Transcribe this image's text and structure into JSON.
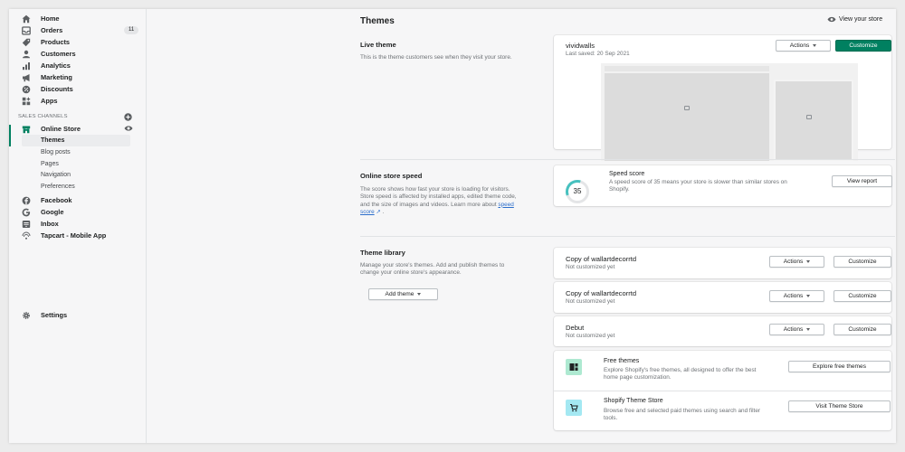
{
  "sidebar": {
    "items": [
      {
        "label": "Home",
        "icon": "home-icon"
      },
      {
        "label": "Orders",
        "icon": "orders-icon",
        "badge": "11"
      },
      {
        "label": "Products",
        "icon": "products-icon"
      },
      {
        "label": "Customers",
        "icon": "customers-icon"
      },
      {
        "label": "Analytics",
        "icon": "analytics-icon"
      },
      {
        "label": "Marketing",
        "icon": "marketing-icon"
      },
      {
        "label": "Discounts",
        "icon": "discounts-icon"
      },
      {
        "label": "Apps",
        "icon": "apps-icon"
      }
    ],
    "sales_channels_label": "SALES CHANNELS",
    "online_store": "Online Store",
    "sub_items": [
      {
        "label": "Themes",
        "active": true
      },
      {
        "label": "Blog posts"
      },
      {
        "label": "Pages"
      },
      {
        "label": "Navigation"
      },
      {
        "label": "Preferences"
      }
    ],
    "channels": [
      {
        "label": "Facebook",
        "icon": "facebook-icon"
      },
      {
        "label": "Google",
        "icon": "google-icon"
      },
      {
        "label": "Inbox",
        "icon": "inbox-icon"
      },
      {
        "label": "Tapcart - Mobile App",
        "icon": "tapcart-icon"
      }
    ],
    "settings": "Settings"
  },
  "header": {
    "title": "Themes",
    "view_store": "View your store"
  },
  "live_theme": {
    "heading": "Live theme",
    "description": "This is the theme customers see when they visit your store.",
    "name": "vividwalls",
    "last_saved": "Last saved: 20 Sep 2021",
    "actions_label": "Actions",
    "customize_label": "Customize"
  },
  "speed": {
    "heading": "Online store speed",
    "description": "The score shows how fast your store is loading for visitors. Store speed is affected by installed apps, edited theme code, and the size of images and videos. Learn more about",
    "link": "speed score",
    "link_suffix": ".",
    "score": "35",
    "score_fraction": 0.35,
    "title": "Speed score",
    "text": "A speed score of 35 means your store is slower than similar stores on Shopify.",
    "button": "View report"
  },
  "library": {
    "heading": "Theme library",
    "description": "Manage your store's themes. Add and publish themes to change your online store's appearance.",
    "add_theme": "Add theme",
    "themes": [
      {
        "name": "Copy of wallartdecorrtd",
        "status": "Not customized yet",
        "actions": "Actions",
        "customize": "Customize"
      },
      {
        "name": "Copy of wallartdecorrtd",
        "status": "Not customized yet",
        "actions": "Actions",
        "customize": "Customize"
      },
      {
        "name": "Debut",
        "status": "Not customized yet",
        "actions": "Actions",
        "customize": "Customize"
      }
    ],
    "free_themes": {
      "title": "Free themes",
      "text": "Explore Shopify's free themes, all designed to offer the best home page customization.",
      "button": "Explore free themes",
      "icon": "free-themes-icon"
    },
    "theme_store": {
      "title": "Shopify Theme Store",
      "text": "Browse free and selected paid themes using search and filter tools.",
      "button": "Visit Theme Store",
      "icon": "theme-store-icon"
    }
  },
  "colors": {
    "accent": "#008060",
    "link": "#2c6ecb",
    "gauge": "#47c1bf",
    "free_icon_bg": "#aee9d1",
    "store_icon_bg": "#a4e8f2"
  }
}
